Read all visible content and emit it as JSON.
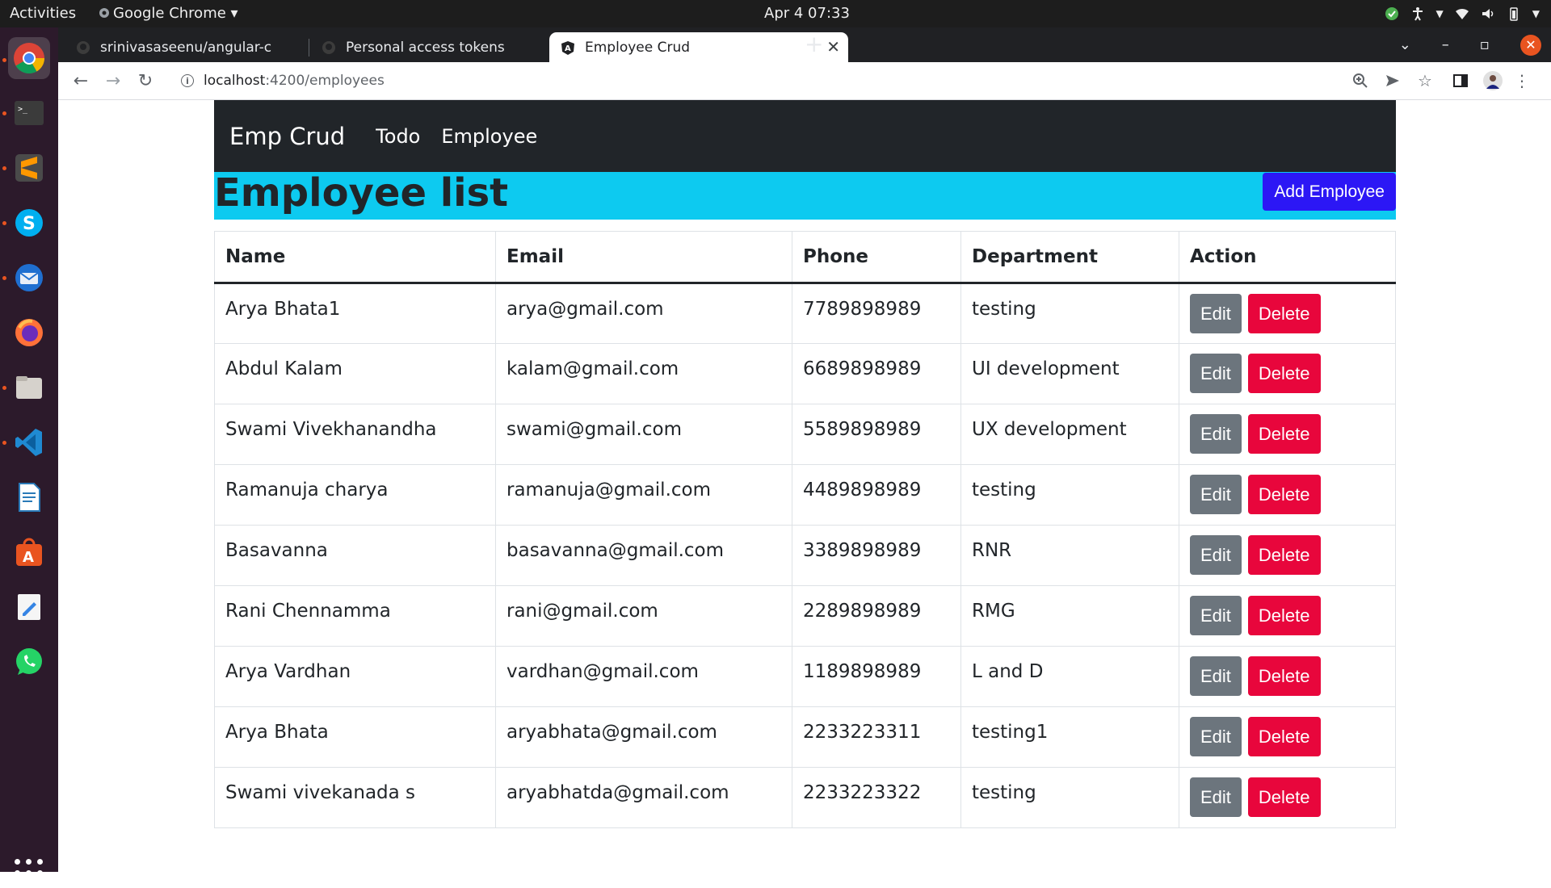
{
  "system": {
    "activities": "Activities",
    "app_menu": "Google Chrome ▾",
    "clock": "Apr 4  07:33"
  },
  "dock": {
    "items": [
      "chrome",
      "terminal",
      "sublime-text",
      "skype",
      "thunderbird",
      "firefox",
      "files",
      "vscode",
      "libreoffice-writer",
      "software-center",
      "text-editor",
      "whatsapp"
    ]
  },
  "browser": {
    "tabs": [
      {
        "title": "srinivasaseenu/angular-cr",
        "icon": "github-icon"
      },
      {
        "title": "Personal access tokens",
        "icon": "github-icon"
      },
      {
        "title": "Employee Crud",
        "icon": "angular-icon"
      }
    ],
    "active_tab": 2,
    "url_host": "localhost",
    "url_path": ":4200/employees"
  },
  "app": {
    "brand": "Emp Crud",
    "nav": [
      "Todo",
      "Employee"
    ],
    "title": "Employee list",
    "add_button": "Add Employee",
    "columns": [
      "Name",
      "Email",
      "Phone",
      "Department",
      "Action"
    ],
    "edit_label": "Edit",
    "delete_label": "Delete",
    "rows": [
      {
        "name": "Arya Bhata1",
        "email": "arya@gmail.com",
        "phone": "7789898989",
        "department": "testing"
      },
      {
        "name": "Abdul Kalam",
        "email": "kalam@gmail.com",
        "phone": "6689898989",
        "department": "UI development"
      },
      {
        "name": "Swami Vivekhanandha",
        "email": "swami@gmail.com",
        "phone": "5589898989",
        "department": "UX development"
      },
      {
        "name": "Ramanuja charya",
        "email": "ramanuja@gmail.com",
        "phone": "4489898989",
        "department": "testing"
      },
      {
        "name": "Basavanna",
        "email": "basavanna@gmail.com",
        "phone": "3389898989",
        "department": "RNR"
      },
      {
        "name": "Rani Chennamma",
        "email": "rani@gmail.com",
        "phone": "2289898989",
        "department": "RMG"
      },
      {
        "name": "Arya Vardhan",
        "email": "vardhan@gmail.com",
        "phone": "1189898989",
        "department": "L and D"
      },
      {
        "name": "Arya Bhata",
        "email": "aryabhata@gmail.com",
        "phone": "2233223311",
        "department": "testing1"
      },
      {
        "name": "Swami vivekanada s",
        "email": "aryabhatda@gmail.com",
        "phone": "2233223322",
        "department": "testing"
      }
    ]
  },
  "colors": {
    "navbar": "#212529",
    "header_bg": "#0dcaf0",
    "add_button": "#2c17f5",
    "edit_button": "#6c757d",
    "delete_button": "#e8063c",
    "dock": "#2c1a2b"
  }
}
